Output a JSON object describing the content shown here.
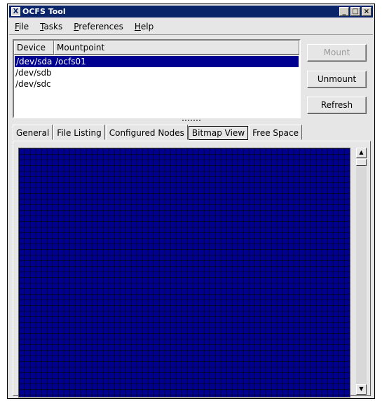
{
  "window": {
    "title": "OCFS Tool",
    "icon_glyph": "X",
    "min_glyph": "_",
    "max_glyph": "□",
    "close_glyph": "×"
  },
  "menu": [
    {
      "label": "File",
      "u": "F",
      "rest": "ile"
    },
    {
      "label": "Tasks",
      "u": "T",
      "rest": "asks"
    },
    {
      "label": "Preferences",
      "u": "P",
      "rest": "references"
    },
    {
      "label": "Help",
      "u": "H",
      "rest": "elp"
    }
  ],
  "device_list": {
    "columns": [
      "Device",
      "Mountpoint"
    ],
    "rows": [
      {
        "device": "/dev/sda",
        "mountpoint": "/ocfs01",
        "selected": true
      },
      {
        "device": "/dev/sdb",
        "mountpoint": "",
        "selected": false
      },
      {
        "device": "/dev/sdc",
        "mountpoint": "",
        "selected": false
      }
    ]
  },
  "buttons": {
    "mount": "Mount",
    "unmount": "Unmount",
    "refresh": "Refresh"
  },
  "tabs": [
    "General",
    "File Listing",
    "Configured Nodes",
    "Bitmap View",
    "Free Space"
  ],
  "active_tab": "Bitmap View",
  "bitmap": {
    "fill_color": "#000090"
  },
  "scrollbar": {
    "up_glyph": "▲",
    "down_glyph": "▼"
  }
}
